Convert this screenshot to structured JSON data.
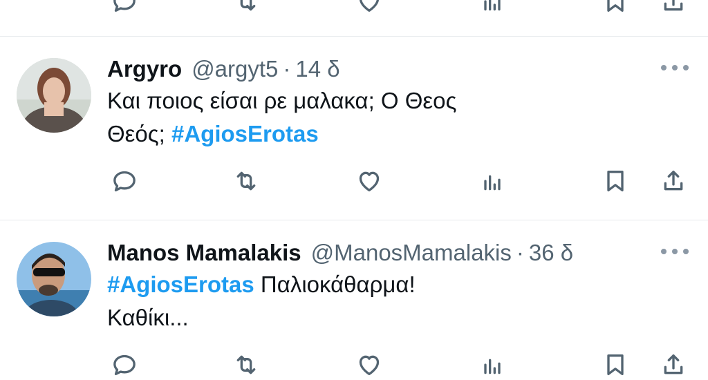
{
  "tweets": [
    {
      "name": "Argyro",
      "handle": "@argyt5",
      "separator": "·",
      "time": "14 δ",
      "line1": "Και ποιος είσαι ρε μαλακα; Ο Θεος",
      "line2_prefix": "Θεός; ",
      "hashtag": "#AgiosErotas"
    },
    {
      "name": "Manos Mamalakis",
      "handle": "@ManosMamalakis",
      "separator": "·",
      "time": "36 δ",
      "hashtag": "#AgiosErotas",
      "line1_suffix": " Παλιοκάθαρμα!",
      "line2": "Καθίκι..."
    }
  ],
  "icons": {
    "reply": "reply-icon",
    "retweet": "retweet-icon",
    "like": "heart-icon",
    "views": "views-icon",
    "bookmark": "bookmark-icon",
    "share": "share-icon",
    "more": "more-dots-icon"
  },
  "colors": {
    "hashtag": "#1d9bf0",
    "secondary_text": "#536471",
    "primary_text": "#0f1419",
    "divider": "#e6e9ec"
  }
}
